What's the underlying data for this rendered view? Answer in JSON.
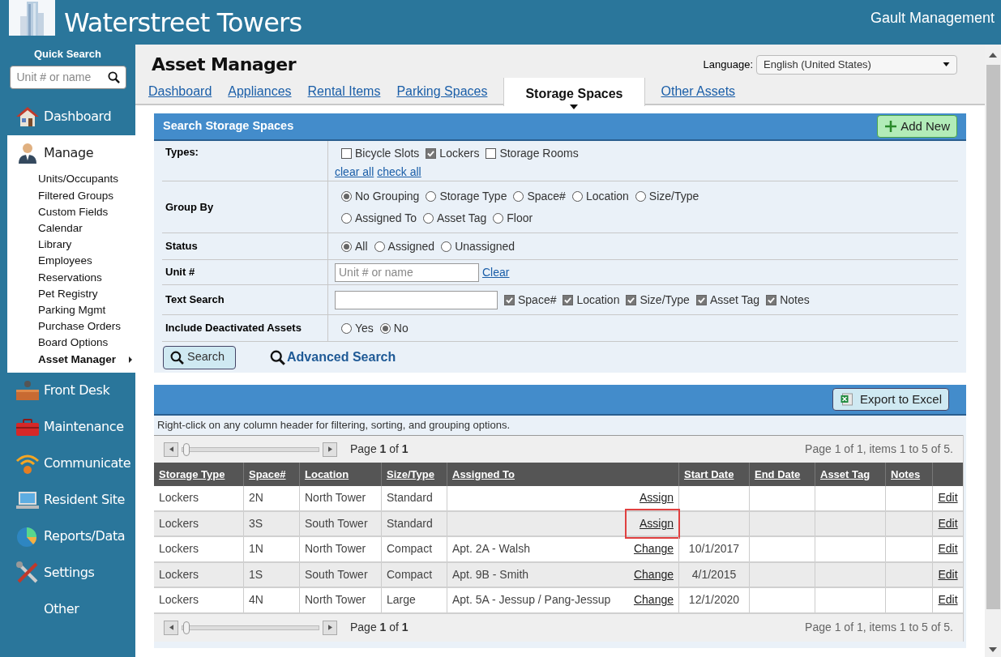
{
  "header": {
    "title": "Waterstreet Towers",
    "company": "Gault Management"
  },
  "sidebar": {
    "quick_search": {
      "label": "Quick Search",
      "placeholder": "Unit # or name"
    },
    "items": [
      {
        "label": "Dashboard",
        "kind": "house",
        "expanded": false
      },
      {
        "label": "Manage",
        "kind": "person",
        "expanded": true,
        "children": [
          {
            "label": "Units/Occupants",
            "selected": false
          },
          {
            "label": "Filtered Groups",
            "selected": false
          },
          {
            "label": "Custom Fields",
            "selected": false
          },
          {
            "label": "Calendar",
            "selected": false
          },
          {
            "label": "Library",
            "selected": false
          },
          {
            "label": "Employees",
            "selected": false
          },
          {
            "label": "Reservations",
            "selected": false
          },
          {
            "label": "Pet Registry",
            "selected": false
          },
          {
            "label": "Parking Mgmt",
            "selected": false
          },
          {
            "label": "Purchase Orders",
            "selected": false
          },
          {
            "label": "Board Options",
            "selected": false
          },
          {
            "label": "Asset Manager",
            "selected": true
          }
        ]
      },
      {
        "label": "Front Desk",
        "kind": "desk",
        "expanded": false
      },
      {
        "label": "Maintenance",
        "kind": "toolbox",
        "expanded": false
      },
      {
        "label": "Communicate",
        "kind": "wifi",
        "expanded": false
      },
      {
        "label": "Resident Site",
        "kind": "laptop",
        "expanded": false
      },
      {
        "label": "Reports/Data",
        "kind": "pie",
        "expanded": false
      },
      {
        "label": "Settings",
        "kind": "tools",
        "expanded": false
      },
      {
        "label": "Other",
        "kind": "none",
        "expanded": false
      }
    ]
  },
  "page": {
    "title": "Asset Manager",
    "language": {
      "label": "Language:",
      "value": "English (United States)"
    }
  },
  "tabs": [
    {
      "label": "Dashboard",
      "selected": false
    },
    {
      "label": "Appliances",
      "selected": false
    },
    {
      "label": "Rental Items",
      "selected": false
    },
    {
      "label": "Parking Spaces",
      "selected": false
    },
    {
      "label": "Storage Spaces",
      "selected": true
    },
    {
      "label": "Other Assets",
      "selected": false
    }
  ],
  "search_panel": {
    "title": "Search Storage Spaces",
    "add_button": "Add New",
    "rows": [
      {
        "label": "Types:",
        "kind": "checks",
        "options": [
          {
            "label": "Bicycle Slots",
            "checked": false
          },
          {
            "label": "Lockers",
            "checked": true
          },
          {
            "label": "Storage Rooms",
            "checked": false
          }
        ],
        "links": [
          "clear all",
          "check all"
        ]
      },
      {
        "label": "Group By",
        "kind": "radios",
        "options": [
          {
            "label": "No Grouping",
            "selected": true
          },
          {
            "label": "Storage Type",
            "selected": false
          },
          {
            "label": "Space#",
            "selected": false
          },
          {
            "label": "Location",
            "selected": false
          },
          {
            "label": "Size/Type",
            "selected": false
          },
          {
            "label": "Assigned To",
            "selected": false
          },
          {
            "label": "Asset Tag",
            "selected": false
          },
          {
            "label": "Floor",
            "selected": false
          }
        ]
      },
      {
        "label": "Status",
        "kind": "radios",
        "options": [
          {
            "label": "All",
            "selected": true
          },
          {
            "label": "Assigned",
            "selected": false
          },
          {
            "label": "Unassigned",
            "selected": false
          }
        ]
      },
      {
        "label": "Unit #",
        "kind": "unit",
        "placeholder": "Unit # or name",
        "link": "Clear"
      },
      {
        "label": "Text Search",
        "kind": "text",
        "options": [
          {
            "label": "Space#",
            "checked": true
          },
          {
            "label": "Location",
            "checked": true
          },
          {
            "label": "Size/Type",
            "checked": true
          },
          {
            "label": "Asset Tag",
            "checked": true
          },
          {
            "label": "Notes",
            "checked": true
          }
        ]
      },
      {
        "label": "Include Deactivated Assets",
        "kind": "radios",
        "options": [
          {
            "label": "Yes",
            "selected": false
          },
          {
            "label": "No",
            "selected": true
          }
        ]
      }
    ],
    "search_button": "Search",
    "advanced_search": "Advanced Search"
  },
  "results": {
    "export_button": "Export to Excel",
    "hint": "Right-click on any column header for filtering, sorting, and grouping options.",
    "pagers": [
      {
        "page": "Page **1** of **1**",
        "summary": "Page 1 of 1, items 1 to 5 of 5.",
        "level": 0
      },
      {
        "page": "Page **1** of **1**",
        "summary": "Page 1 of 1, items 1 to 5 of 5.",
        "level": 0
      }
    ],
    "columns": [
      "Storage Type",
      "Space#",
      "Location",
      "Size/Type",
      "Assigned To",
      "Start Date",
      "End Date",
      "Asset Tag",
      "Notes"
    ],
    "rows": [
      {
        "cells": [
          "Lockers",
          "2N",
          "North Tower",
          "Standard",
          "",
          "",
          "",
          "",
          ""
        ],
        "action": "Assign",
        "highlighted": false,
        "edit": "Edit"
      },
      {
        "cells": [
          "Lockers",
          "3S",
          "South Tower",
          "Standard",
          "",
          "",
          "",
          "",
          ""
        ],
        "action": "Assign",
        "highlighted": true,
        "edit": "Edit"
      },
      {
        "cells": [
          "Lockers",
          "1N",
          "North Tower",
          "Compact",
          "Apt. 2A - Walsh",
          "10/1/2017",
          "",
          "",
          ""
        ],
        "action": "Change",
        "highlighted": false,
        "edit": "Edit"
      },
      {
        "cells": [
          "Lockers",
          "1S",
          "South Tower",
          "Compact",
          "Apt. 9B - Smith",
          "4/1/2015",
          "",
          "",
          ""
        ],
        "action": "Change",
        "highlighted": false,
        "edit": "Edit"
      },
      {
        "cells": [
          "Lockers",
          "4N",
          "North Tower",
          "Large",
          "Apt. 5A - Jessup / Pang-Jessup",
          "12/1/2020",
          "",
          "",
          ""
        ],
        "action": "Change",
        "highlighted": false,
        "edit": "Edit"
      }
    ]
  }
}
